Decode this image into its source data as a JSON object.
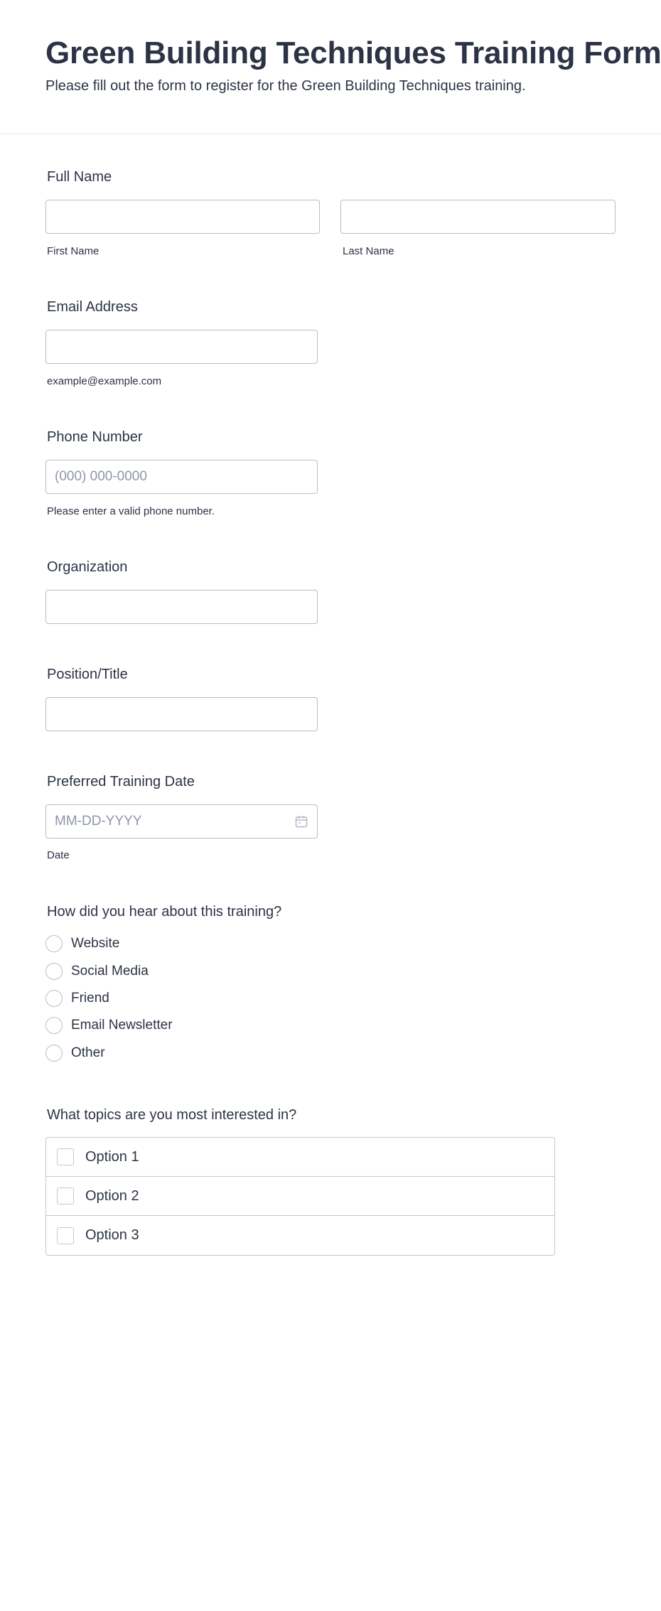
{
  "header": {
    "title": "Green Building Techniques Training Form",
    "subtitle": "Please fill out the form to register for the Green Building Techniques training."
  },
  "full_name": {
    "label": "Full Name",
    "first_value": "",
    "last_value": "",
    "first_sublabel": "First Name",
    "last_sublabel": "Last Name"
  },
  "email": {
    "label": "Email Address",
    "value": "",
    "sublabel": "example@example.com"
  },
  "phone": {
    "label": "Phone Number",
    "placeholder": "(000) 000-0000",
    "sublabel": "Please enter a valid phone number."
  },
  "organization": {
    "label": "Organization",
    "value": ""
  },
  "position": {
    "label": "Position/Title",
    "value": ""
  },
  "training_date": {
    "label": "Preferred Training Date",
    "placeholder": "MM-DD-YYYY",
    "sublabel": "Date",
    "icon": "calendar-icon"
  },
  "hear_about": {
    "label": "How did you hear about this training?",
    "options": [
      "Website",
      "Social Media",
      "Friend",
      "Email Newsletter",
      "Other"
    ]
  },
  "topics": {
    "label": "What topics are you most interested in?",
    "options": [
      "Option 1",
      "Option 2",
      "Option 3"
    ]
  }
}
